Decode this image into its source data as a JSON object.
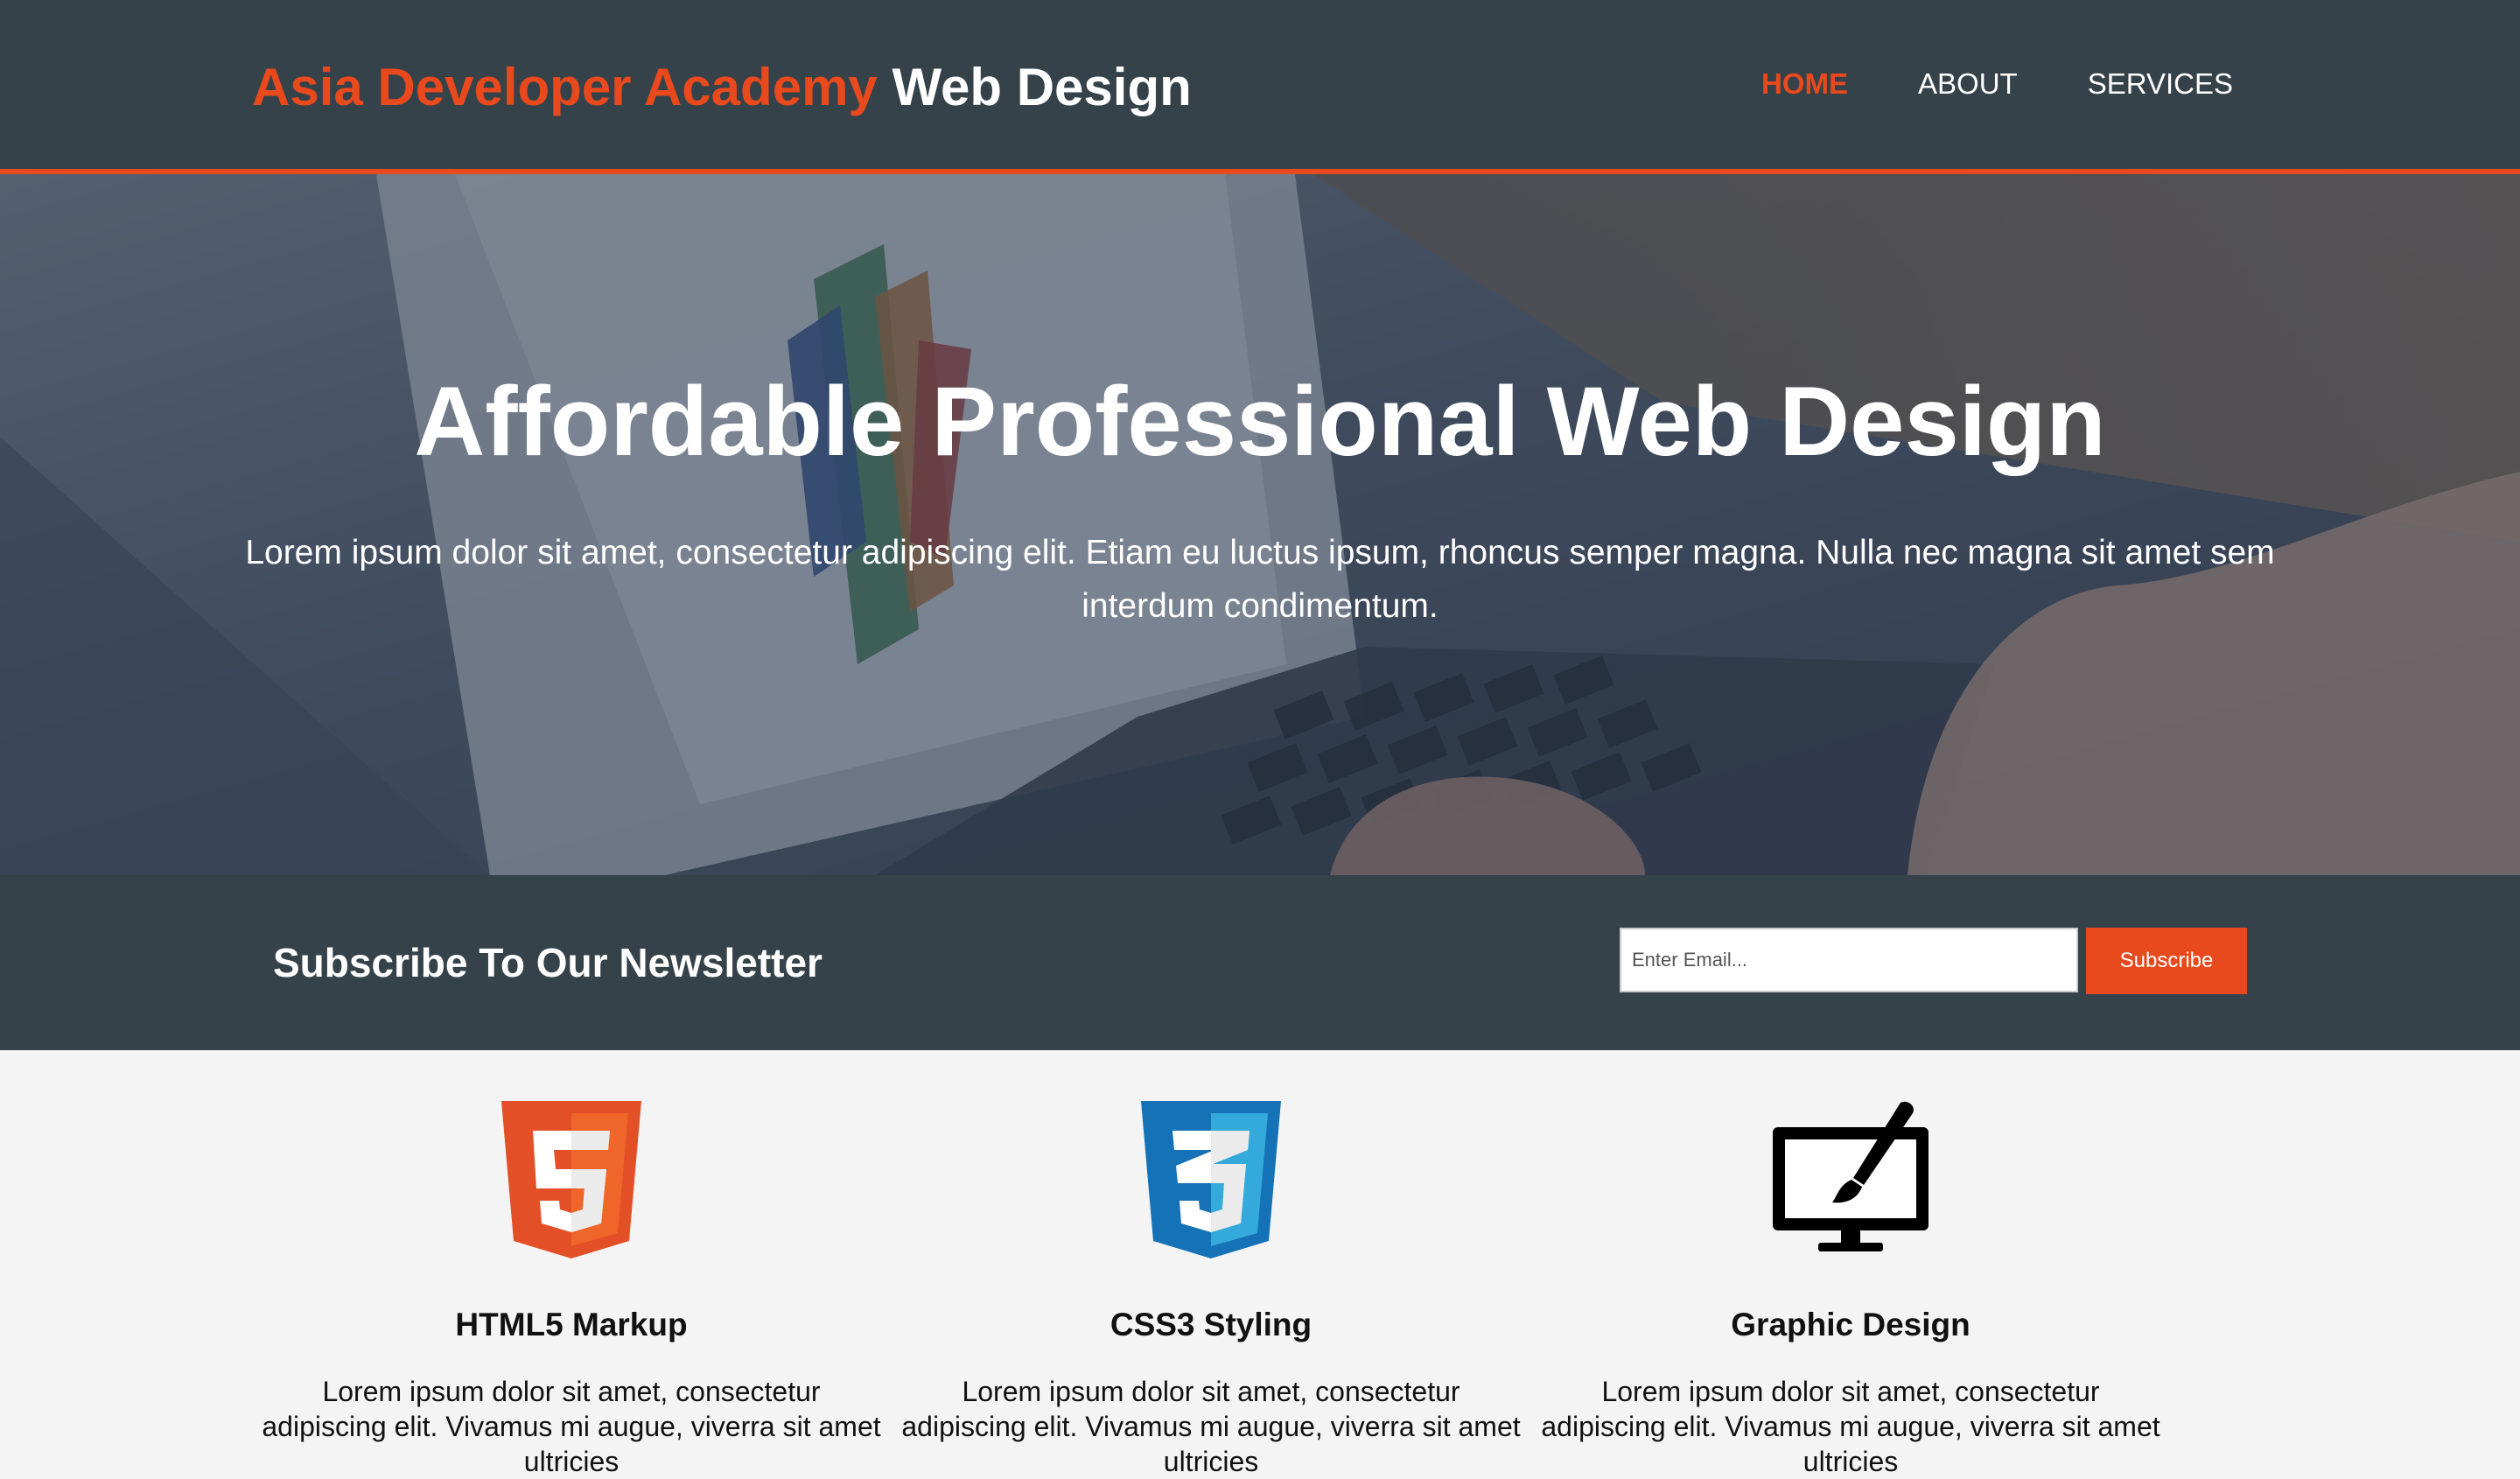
{
  "header": {
    "brand_highlight": "Asia Developer Academy",
    "brand_rest": " Web Design",
    "nav": [
      {
        "label": "HOME",
        "current": true
      },
      {
        "label": "ABOUT",
        "current": false
      },
      {
        "label": "SERVICES",
        "current": false
      }
    ]
  },
  "showcase": {
    "title": "Affordable Professional Web Design",
    "text": "Lorem ipsum dolor sit amet, consectetur adipiscing elit. Etiam eu luctus ipsum, rhoncus semper magna. Nulla nec magna sit amet sem interdum condimentum."
  },
  "newsletter": {
    "title": "Subscribe To Our Newsletter",
    "email_placeholder": "Enter Email...",
    "button_label": "Subscribe"
  },
  "boxes": [
    {
      "title": "HTML5 Markup",
      "icon": "html5-logo-icon",
      "text": "Lorem ipsum dolor sit amet, consectetur adipiscing elit. Vivamus mi augue, viverra sit amet ultricies"
    },
    {
      "title": "CSS3 Styling",
      "icon": "css3-logo-icon",
      "text": "Lorem ipsum dolor sit amet, consectetur adipiscing elit. Vivamus mi augue, viverra sit amet ultricies"
    },
    {
      "title": "Graphic Design",
      "icon": "monitor-brush-icon",
      "text": "Lorem ipsum dolor sit amet, consectetur adipiscing elit. Vivamus mi augue, viverra sit amet ultricies"
    }
  ],
  "colors": {
    "accent": "#e8491d",
    "header_bg": "#35424a",
    "body_bg": "#f4f4f4"
  }
}
